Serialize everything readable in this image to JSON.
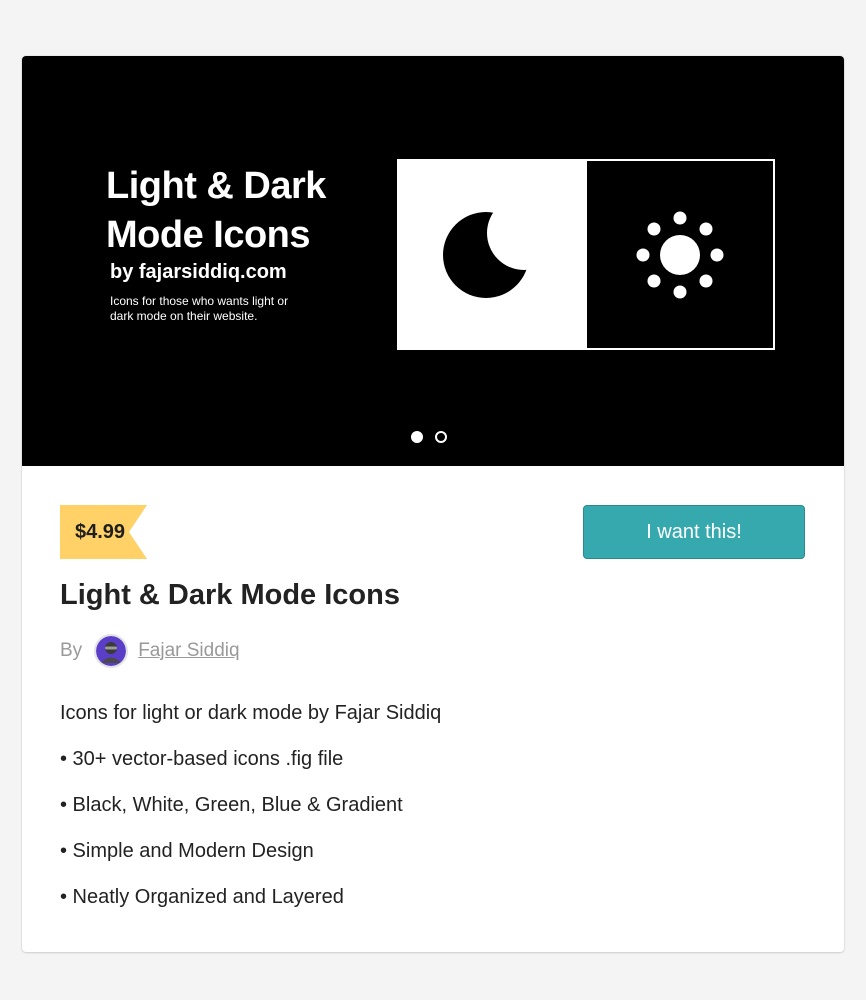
{
  "cover": {
    "title_line1": "Light & Dark",
    "title_line2": "Mode Icons",
    "byline": "by fajarsiddiq.com",
    "desc_line1": "Icons for those who wants light or",
    "desc_line2": "dark mode on their website."
  },
  "icons": {
    "light_panel": "moon-icon",
    "dark_panel": "sun-icon"
  },
  "carousel": {
    "count": 2,
    "active_index": 0
  },
  "product": {
    "price": "$4.99",
    "buy_label": "I want this!",
    "title": "Light & Dark Mode Icons",
    "by_label": "By",
    "author": "Fajar Siddiq",
    "description": [
      "Icons for light or dark mode by Fajar Siddiq",
      "• 30+ vector-based icons .fig file",
      "• Black, White, Green, Blue & Gradient",
      "• Simple and Modern Design",
      "• Neatly Organized and Layered"
    ]
  },
  "colors": {
    "page_background": "#f4f4f4",
    "cover_background": "#000000",
    "price_tag": "#ffd166",
    "buy_button": "#36a9ae",
    "author_text": "#999999"
  }
}
